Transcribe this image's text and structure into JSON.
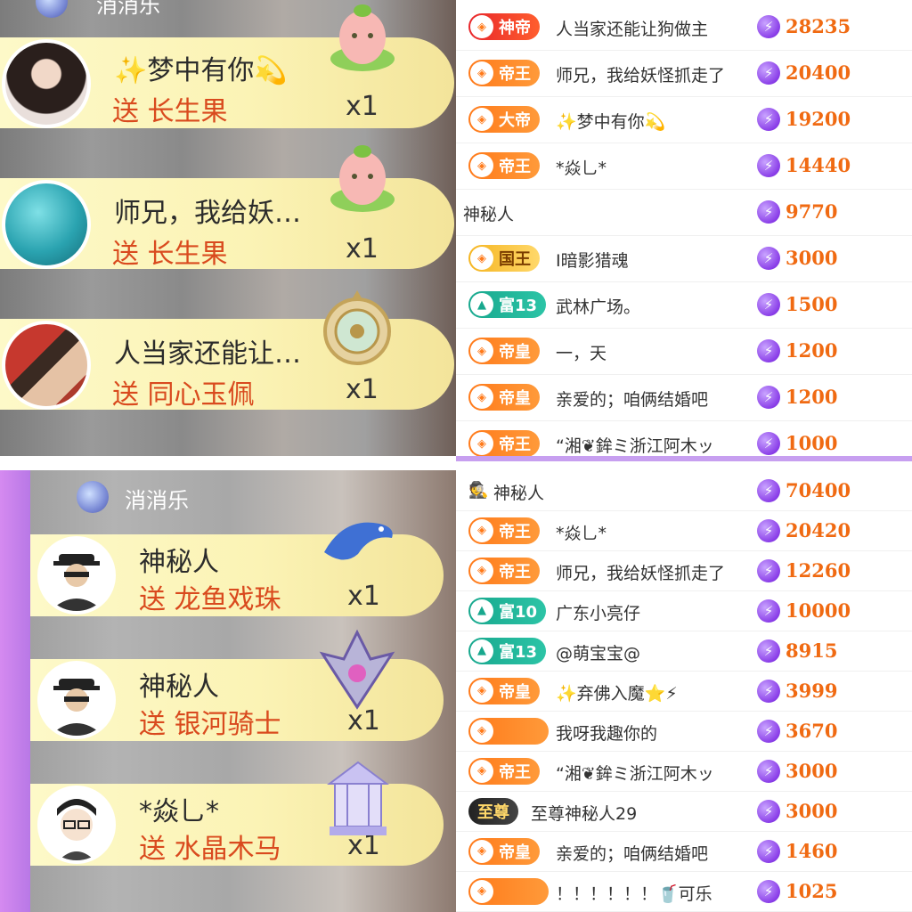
{
  "gift_top": {
    "room_title": "消消乐",
    "cards": [
      {
        "name": "✨梦中有你💫",
        "gift": "送 长生果",
        "count": "x1",
        "gift_icon": "peach-baby-icon"
      },
      {
        "name": "师兄，我给妖…",
        "gift": "送 长生果",
        "count": "x1",
        "gift_icon": "peach-baby-icon"
      },
      {
        "name": "人当家还能让…",
        "gift": "送 同心玉佩",
        "count": "x1",
        "gift_icon": "jade-pendant-icon"
      }
    ]
  },
  "gift_bottom": {
    "room_title": "消消乐",
    "cards": [
      {
        "name": "神秘人",
        "gift": "送 龙鱼戏珠",
        "count": "x1",
        "gift_icon": "dragon-fish-icon"
      },
      {
        "name": "神秘人",
        "gift": "送 银河骑士",
        "count": "x1",
        "gift_icon": "galaxy-knight-icon"
      },
      {
        "name": "*焱乚*",
        "gift": "送 水晶木马",
        "count": "x1",
        "gift_icon": "crystal-carousel-icon"
      }
    ]
  },
  "rank_top": [
    {
      "badge": "神帝",
      "badge_style": "red",
      "name": "人当家还能让狗做主",
      "score": "28235"
    },
    {
      "badge": "帝王",
      "badge_style": "orange",
      "name": "师兄，我给妖怪抓走了",
      "score": "20400"
    },
    {
      "badge": "大帝",
      "badge_style": "orange",
      "name": "✨梦中有你💫",
      "score": "19200"
    },
    {
      "badge": "帝王",
      "badge_style": "orange",
      "name": "*焱乚*",
      "score": "14440"
    },
    {
      "badge": "",
      "badge_style": "none",
      "name": "神秘人",
      "score": "9770"
    },
    {
      "badge": "国王",
      "badge_style": "gold",
      "name": "I暗影猎魂",
      "score": "3000"
    },
    {
      "badge": "富13",
      "badge_style": "teal",
      "name": "武林广场。",
      "score": "1500"
    },
    {
      "badge": "帝皇",
      "badge_style": "orange",
      "name": "一，天",
      "score": "1200"
    },
    {
      "badge": "帝皇",
      "badge_style": "orange",
      "name": "亲爱的；咱俩结婚吧",
      "score": "1200"
    },
    {
      "badge": "帝王",
      "badge_style": "orange",
      "name": "“湘❦鉾ミ浙江阿木ッ",
      "score": "1000"
    }
  ],
  "rank_bottom": [
    {
      "badge": "",
      "badge_style": "incognito",
      "name": "神秘人",
      "score": "70400"
    },
    {
      "badge": "帝王",
      "badge_style": "orange",
      "name": "*焱乚*",
      "score": "20420"
    },
    {
      "badge": "帝王",
      "badge_style": "orange",
      "name": "师兄，我给妖怪抓走了",
      "score": "12260"
    },
    {
      "badge": "富10",
      "badge_style": "teal",
      "name": "广东小亮仔",
      "score": "10000"
    },
    {
      "badge": "富13",
      "badge_style": "teal",
      "name": "@萌宝宝@",
      "score": "8915"
    },
    {
      "badge": "帝皇",
      "badge_style": "orange",
      "name": "✨弃佛入魔⭐⚡",
      "score": "3999"
    },
    {
      "badge": "",
      "badge_style": "orange-blank",
      "name": "我呀我趣你的",
      "score": "3670"
    },
    {
      "badge": "帝王",
      "badge_style": "orange",
      "name": "“湘❦鉾ミ浙江阿木ッ",
      "score": "3000"
    },
    {
      "badge": "至尊",
      "badge_style": "black",
      "name": "至尊神秘人29",
      "score": "3000"
    },
    {
      "badge": "帝皇",
      "badge_style": "orange",
      "name": "亲爱的；咱俩结婚吧",
      "score": "1460"
    },
    {
      "badge": "",
      "badge_style": "orange-blank",
      "name": "！！！！！！🥤可乐",
      "score": "1025"
    }
  ],
  "colors": {
    "score": "#f06a12",
    "gift_text": "#d94a1e",
    "card_bg": "#fbf3b5",
    "divider": "#c79ff0"
  }
}
